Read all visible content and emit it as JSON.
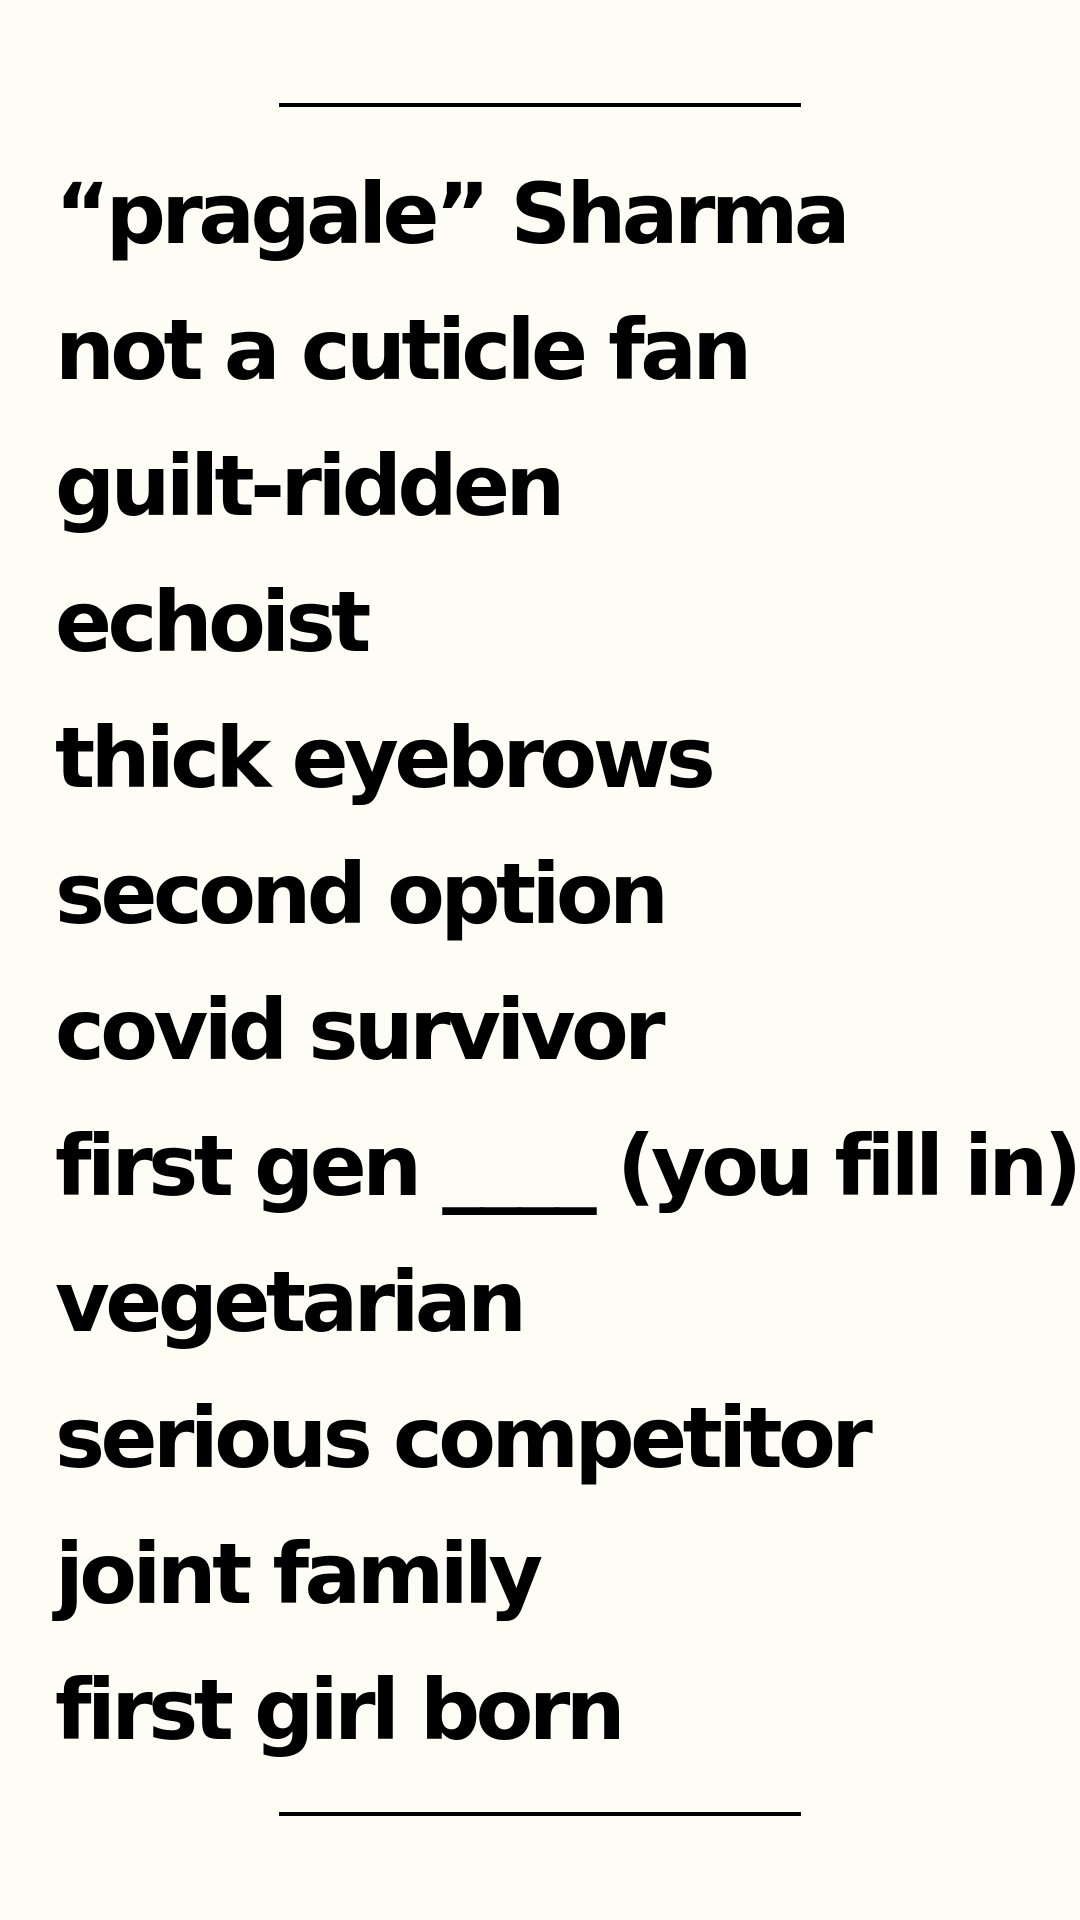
{
  "lines": [
    " “pragale” Sharma",
    "not a cuticle fan",
    "guilt-ridden",
    "echoist",
    "thick eyebrows",
    "second option",
    "covid survivor",
    "first gen ____ (you fill in)",
    "vegetarian",
    "serious competitor",
    "joint family",
    "first girl born"
  ],
  "colors": {
    "background": "#fdfdf5",
    "text": "#000000"
  }
}
